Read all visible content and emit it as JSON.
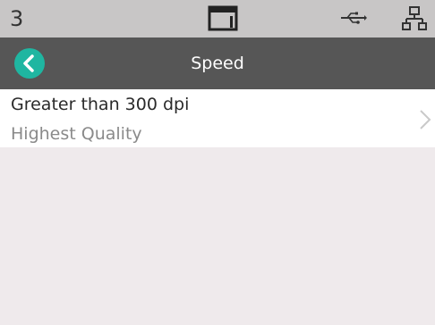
{
  "status_bar": {
    "count": "3",
    "icons": [
      "display-icon",
      "usb-icon",
      "network-icon"
    ]
  },
  "title_bar": {
    "title": "Speed",
    "back_icon": "back-arrow-icon",
    "accent_color": "#1fb6a1"
  },
  "setting": {
    "label": "Greater than 300 dpi",
    "value": "Highest Quality",
    "chevron_icon": "chevron-right-icon"
  }
}
